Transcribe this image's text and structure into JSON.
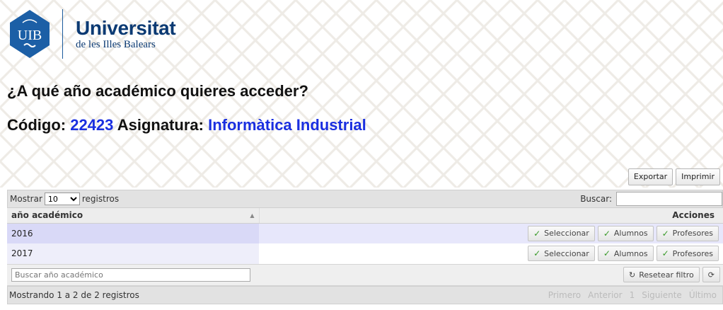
{
  "logo": {
    "seal_text": "UIB",
    "name": "Universitat",
    "subname": "de les Illes Balears"
  },
  "heading": "¿A qué año académico quieres acceder?",
  "code_label": "Código:",
  "code_value": "22423",
  "subject_label": "Asignatura:",
  "subject_value": "Informàtica Industrial",
  "buttons": {
    "export": "Exportar",
    "print": "Imprimir"
  },
  "toolbar": {
    "show_label": "Mostrar",
    "show_value": "10",
    "records_label": "registros",
    "search_label": "Buscar:"
  },
  "table": {
    "col1": "año académico",
    "col2": "Acciones",
    "rows": [
      {
        "year": "2016"
      },
      {
        "year": "2017"
      }
    ],
    "actions": {
      "select": "Seleccionar",
      "students": "Alumnos",
      "teachers": "Profesores"
    }
  },
  "filter": {
    "placeholder": "Buscar año académico",
    "reset": "Resetear filtro"
  },
  "footer": {
    "info": "Mostrando 1 a 2 de 2 registros",
    "first": "Primero",
    "prev": "Anterior",
    "page": "1",
    "next": "Siguiente",
    "last": "Último"
  },
  "colors": {
    "brand": "#0b3a73",
    "highlight": "#1a2fe0",
    "check": "#3a9a2a"
  }
}
